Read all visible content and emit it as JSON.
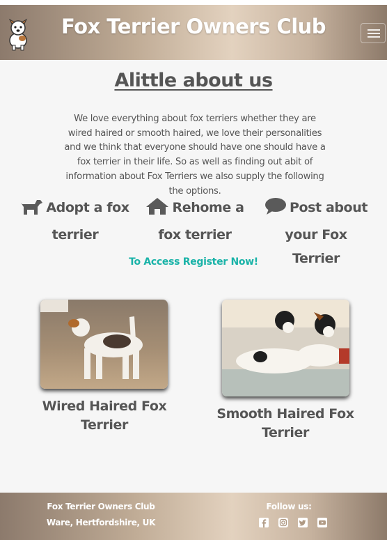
{
  "header": {
    "title": "Fox Terrier Owners Club",
    "logo_icon": "fox-terrier-cartoon-icon",
    "menu_icon": "hamburger-menu-icon"
  },
  "about": {
    "heading": "Alittle about us",
    "text": "We love everything about fox terriers whether they are wired haired or smooth haired, we love their personalities and we think that everyone should have one should have a fox terrier in their life. So as well as finding out abit of information about Fox Terriers we also supply the following the options."
  },
  "options": [
    {
      "label": "Adopt a fox terrier",
      "icon": "dog-icon"
    },
    {
      "label": "Rehome a fox terrier",
      "icon": "home-icon"
    },
    {
      "label": "Post about your Fox Terrier",
      "icon": "comment-icon"
    }
  ],
  "register_link": "To Access Register Now!",
  "breeds": [
    {
      "caption": "Wired Haired Fox Terrier"
    },
    {
      "caption": "Smooth Haired Fox Terrier"
    }
  ],
  "footer": {
    "club": "Fox Terrier Owners Club",
    "location": "Ware, Hertfordshire, UK",
    "follow": "Follow us:",
    "social": [
      "facebook-icon",
      "instagram-icon",
      "twitter-icon",
      "youtube-icon"
    ]
  },
  "colors": {
    "accent": "#1ab3a8",
    "text": "#555555",
    "header_gradient_mid": "#e3d2bf"
  }
}
